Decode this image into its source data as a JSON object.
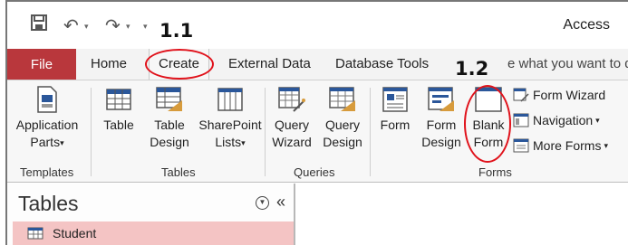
{
  "window": {
    "title": "Access"
  },
  "annotations": {
    "step1": "1.1",
    "step2": "1.2",
    "ring_color": "#e0121b"
  },
  "tabs": {
    "file": "File",
    "items": [
      "Home",
      "Create",
      "External Data",
      "Database Tools"
    ],
    "active": "Create",
    "tell_me": "e what you want to d"
  },
  "ribbon": {
    "templates": {
      "label": "Templates",
      "app_parts_line1": "Application",
      "app_parts_line2": "Parts"
    },
    "tables": {
      "label": "Tables",
      "table": "Table",
      "table_design_1": "Table",
      "table_design_2": "Design",
      "sharepoint_1": "SharePoint",
      "sharepoint_2": "Lists"
    },
    "queries": {
      "label": "Queries",
      "wizard_1": "Query",
      "wizard_2": "Wizard",
      "design_1": "Query",
      "design_2": "Design"
    },
    "forms": {
      "label": "Forms",
      "form": "Form",
      "form_design_1": "Form",
      "form_design_2": "Design",
      "blank_1": "Blank",
      "blank_2": "Form",
      "form_wizard": "Form Wizard",
      "navigation": "Navigation",
      "more_forms": "More Forms"
    }
  },
  "nav_pane": {
    "title": "Tables",
    "items": [
      "Student"
    ]
  },
  "colors": {
    "file_tab": "#b9373c",
    "selected_item": "#f4c4c4",
    "accent_blue": "#2b579a"
  }
}
